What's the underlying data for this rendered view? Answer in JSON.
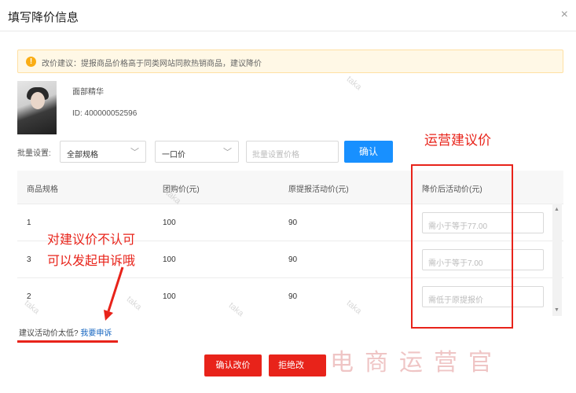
{
  "dialog": {
    "title": "填写降价信息",
    "close_glyph": "×"
  },
  "alert": {
    "icon": "warning-icon",
    "icon_glyph": "!",
    "text": "改价建议：提报商品价格高于同类网站同款热销商品，建议降价"
  },
  "product": {
    "name": "面部精华",
    "id_text": "ID: 400000052596"
  },
  "batch": {
    "label": "批量设置:",
    "spec_select": "全部规格",
    "type_select": "一口价",
    "price_placeholder": "批量设置价格",
    "confirm_label": "确认",
    "chevron_glyph": "﹀"
  },
  "annotation": {
    "ops_label": "运营建议价",
    "line1": "对建议价不认可",
    "line2": "可以发起申诉哦"
  },
  "table": {
    "headers": [
      "商品规格",
      "团购价(元)",
      "原提报活动价(元)",
      "降价后活动价(元)"
    ],
    "rows": [
      {
        "spec": "1",
        "group_price": "100",
        "orig_price": "90",
        "placeholder": "需小于等于77.00"
      },
      {
        "spec": "3",
        "group_price": "100",
        "orig_price": "90",
        "placeholder": "需小于等于7.00"
      },
      {
        "spec": "2",
        "group_price": "100",
        "orig_price": "90",
        "placeholder": "需低于原提报价"
      }
    ],
    "scroll_up_glyph": "▲",
    "scroll_down_glyph": "▼"
  },
  "appeal": {
    "prefix": "建议活动价太低?",
    "link": "我要申诉"
  },
  "footer": {
    "confirm_label": "确认改价",
    "reject_label": "拒绝改"
  },
  "watermark": {
    "text": "电商运营官",
    "ghost_text": "taka"
  },
  "colors": {
    "accent_red": "#e8231a",
    "primary_blue": "#1890ff",
    "warning": "#faad14"
  }
}
